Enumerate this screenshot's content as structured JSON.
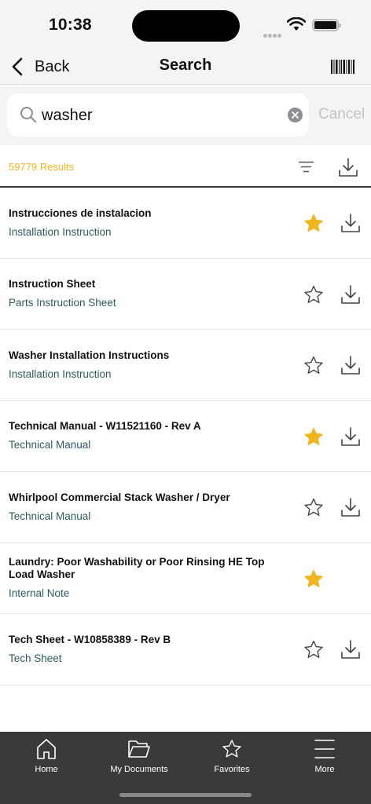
{
  "status": {
    "time": "10:38"
  },
  "nav": {
    "back_label": "Back",
    "title": "Search"
  },
  "search": {
    "value": "washer",
    "cancel_label": "Cancel"
  },
  "results": {
    "count_label": "59779 Results"
  },
  "colors": {
    "accent": "#f2b41f",
    "subtitle": "#2e5a5c",
    "tabbar": "#3a3a3a"
  },
  "items": [
    {
      "title": "Instrucciones de instalacion",
      "subtitle": "Installation Instruction",
      "favorite": true,
      "downloadable": true
    },
    {
      "title": "Instruction Sheet",
      "subtitle": "Parts Instruction Sheet",
      "favorite": false,
      "downloadable": true
    },
    {
      "title": "Washer Installation Instructions",
      "subtitle": "Installation Instruction",
      "favorite": false,
      "downloadable": true
    },
    {
      "title": "Technical Manual - W11521160 - Rev A",
      "subtitle": "Technical Manual",
      "favorite": true,
      "downloadable": true
    },
    {
      "title": "Whirlpool Commercial Stack Washer / Dryer",
      "subtitle": "Technical Manual",
      "favorite": false,
      "downloadable": true
    },
    {
      "title": "Laundry: Poor Washability or Poor Rinsing HE Top Load Washer",
      "subtitle": "Internal Note",
      "favorite": true,
      "downloadable": false
    },
    {
      "title": "Tech Sheet - W10858389 - Rev B",
      "subtitle": "Tech Sheet",
      "favorite": false,
      "downloadable": true
    }
  ],
  "tabs": [
    {
      "label": "Home",
      "icon": "home-icon"
    },
    {
      "label": "My Documents",
      "icon": "folder-icon"
    },
    {
      "label": "Favorites",
      "icon": "star-icon"
    },
    {
      "label": "More",
      "icon": "menu-icon"
    }
  ]
}
